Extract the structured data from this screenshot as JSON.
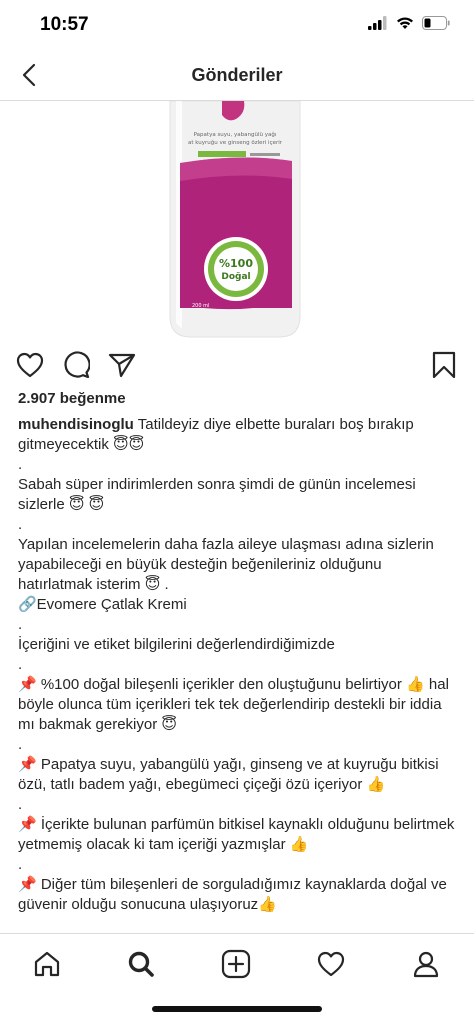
{
  "status_bar": {
    "time": "10:57"
  },
  "nav": {
    "title": "Gönderiler"
  },
  "post": {
    "likes": "2.907 beğenme",
    "username": "muhendisinoglu",
    "caption_first": " Tatildeyiz diye elbette buraları boş bırakıp gitmeyecektik 😇😇",
    "caption_lines": [
      ".",
      "Sabah süper indirimlerden sonra şimdi de günün incelemesi sizlerle 😇 😇",
      ".",
      "Yapılan incelemelerin daha fazla aileye ulaşması adına sizlerin yapabileceği en büyük desteğin beğenileriniz olduğunu hatırlatmak isterim 😇 .",
      "🔗Evomere Çatlak Kremi",
      ".",
      "İçeriğini ve etiket bilgilerini değerlendirdiğimizde",
      ".",
      "📌 %100 doğal bileşenli içerikler den oluştuğunu belirtiyor 👍 hal böyle olunca tüm içerikleri tek tek değerlendirip destekli bir iddia mı bakmak gerekiyor 😇",
      ".",
      "📌 Papatya suyu, yabangülü yağı, ginseng ve at kuyruğu bitkisi özü, tatlı badem yağı, ebegümeci çiçeği özü içeriyor 👍",
      ".",
      "📌 İçerikte bulunan parfümün bitkisel kaynaklı olduğunu belirtmek yetmemiş olacak ki tam içeriği yazmışlar 👍",
      ".",
      "📌 Diğer tüm bileşenleri de sorguladığımız kaynaklarda doğal ve güvenir olduğu sonucuna ulaşıyoruz👍"
    ],
    "product_label": {
      "line1": "Papatya suyu, yabangülü yağı",
      "line2": "at kuyruğu ve ginseng özleri içerir",
      "badge_top": "%100",
      "badge_mid": "Doğal",
      "volume": "200 ml"
    }
  },
  "icons": {
    "like": "heart-icon",
    "comment": "comment-icon",
    "share": "paper-plane-icon",
    "save": "bookmark-icon",
    "home": "home-icon",
    "search": "search-icon",
    "new_post": "plus-square-icon",
    "activity": "heart-outline-icon",
    "profile": "profile-icon"
  },
  "colors": {
    "bottle_magenta": "#b0237a",
    "bottle_green": "#7bb83f",
    "text": "#262626",
    "divider": "#dbdbdb"
  }
}
